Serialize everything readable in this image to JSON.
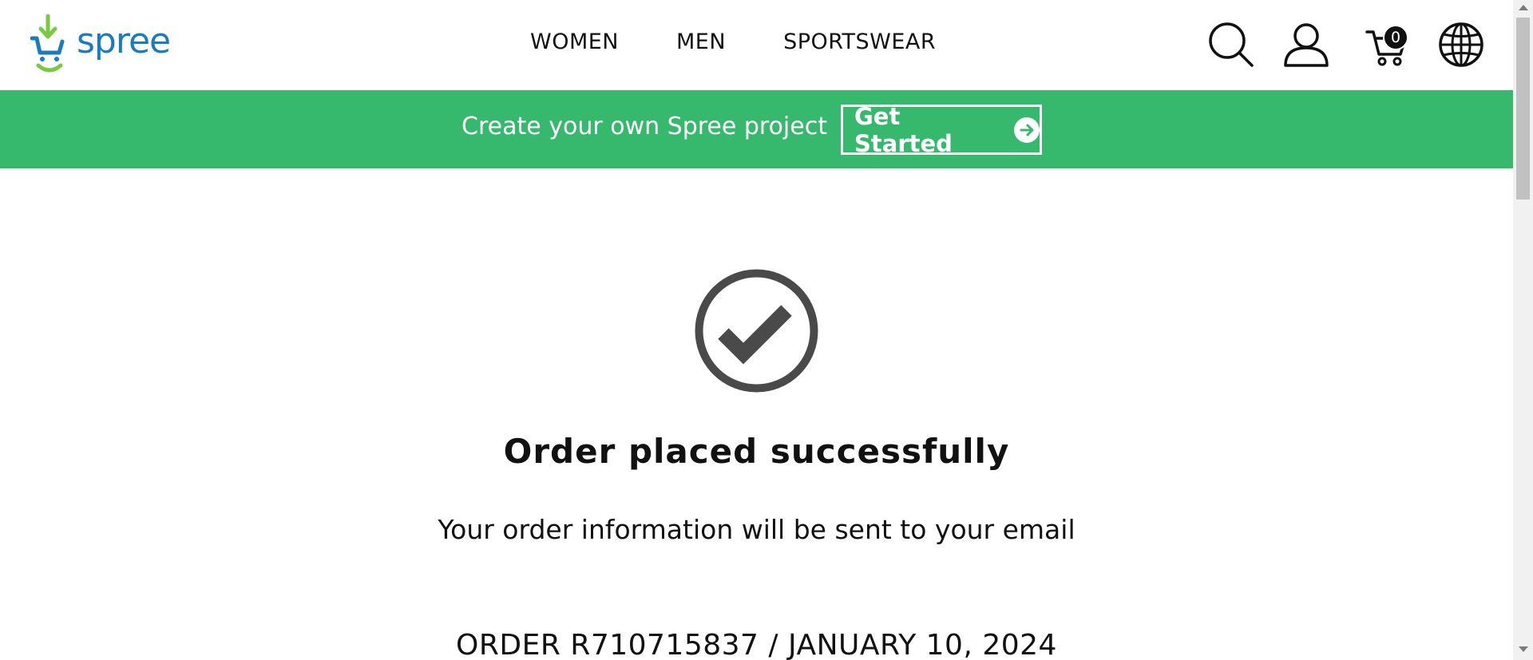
{
  "header": {
    "logo_text": "spree",
    "nav": [
      {
        "label": "WOMEN"
      },
      {
        "label": "MEN"
      },
      {
        "label": "SPORTSWEAR"
      }
    ],
    "icons": [
      "search-icon",
      "account-icon",
      "cart-icon",
      "globe-icon"
    ],
    "cart_count": "0"
  },
  "banner": {
    "text": "Create your own Spree project",
    "button_label": "Get Started",
    "background": "#36b96c"
  },
  "confirmation": {
    "icon": "checkmark-circle-icon",
    "title": "Order placed successfully",
    "subtitle": "Your order information will be sent to your email",
    "order_line": "ORDER R710715837 / JANUARY 10, 2024"
  },
  "colors": {
    "brand_blue": "#1a7bbf",
    "brand_green": "#7ac943",
    "icon_gray": "#4a4a4a"
  }
}
